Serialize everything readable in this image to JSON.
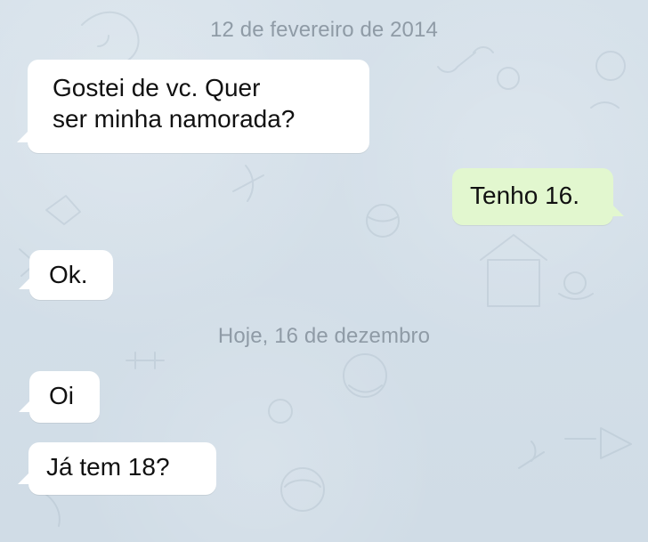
{
  "date_separators": [
    "12 de fevereiro de 2014",
    "Hoje, 16 de dezembro"
  ],
  "messages": [
    {
      "side": "incoming",
      "text": "Gostei de vc. Quer\nser minha namorada?"
    },
    {
      "side": "outgoing",
      "text": "Tenho 16."
    },
    {
      "side": "incoming",
      "text": "Ok."
    },
    {
      "side": "incoming",
      "text": "Oi"
    },
    {
      "side": "incoming",
      "text": "Já tem 18?"
    }
  ],
  "colors": {
    "background": "#d3dfe8",
    "incoming_bubble": "#ffffff",
    "outgoing_bubble": "#e2f7cf",
    "date_text": "#8f9ba6",
    "message_text": "#111111"
  }
}
